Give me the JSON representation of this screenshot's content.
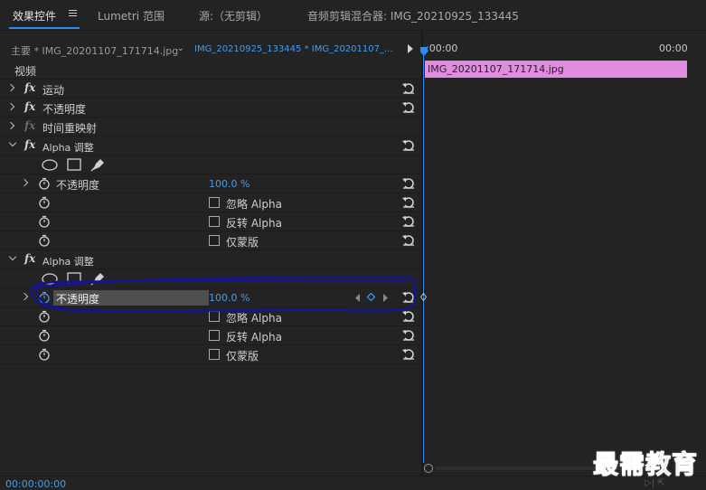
{
  "tabs": {
    "effects": "效果控件",
    "lumetri": "Lumetri 范围",
    "source": "源:（无剪辑）",
    "mixer": "音频剪辑混合器: IMG_20210925_133445"
  },
  "source_row": {
    "master": "主要 * IMG_20201107_171714.jpg",
    "sequence": "IMG_20210925_133445 * IMG_20201107_..."
  },
  "effects": {
    "section_video": "视频",
    "motion": "运动",
    "opacity": "不透明度",
    "time_remap": "时间重映射",
    "alpha1": {
      "name": "Alpha 调整",
      "opacity_label": "不透明度",
      "opacity_value": "100.0 %",
      "ignore_alpha": "忽略 Alpha",
      "invert_alpha": "反转 Alpha",
      "mask_only": "仅蒙版"
    },
    "alpha2": {
      "name": "Alpha 调整",
      "opacity_label": "不透明度",
      "opacity_value": "100.0 %",
      "ignore_alpha": "忽略 Alpha",
      "invert_alpha": "反转 Alpha",
      "mask_only": "仅蒙版"
    }
  },
  "timeline": {
    "start_time": ":00:00",
    "end_time": "00:00",
    "clip_name": "IMG_20201107_171714.jpg",
    "clip_color": "#e08ce0"
  },
  "bottom": {
    "timecode": "00:00:00:00"
  },
  "watermark": "最需教育",
  "colors": {
    "accent": "#2d8ceb",
    "value_blue": "#4a9ae8",
    "annotation": "#14148c"
  }
}
